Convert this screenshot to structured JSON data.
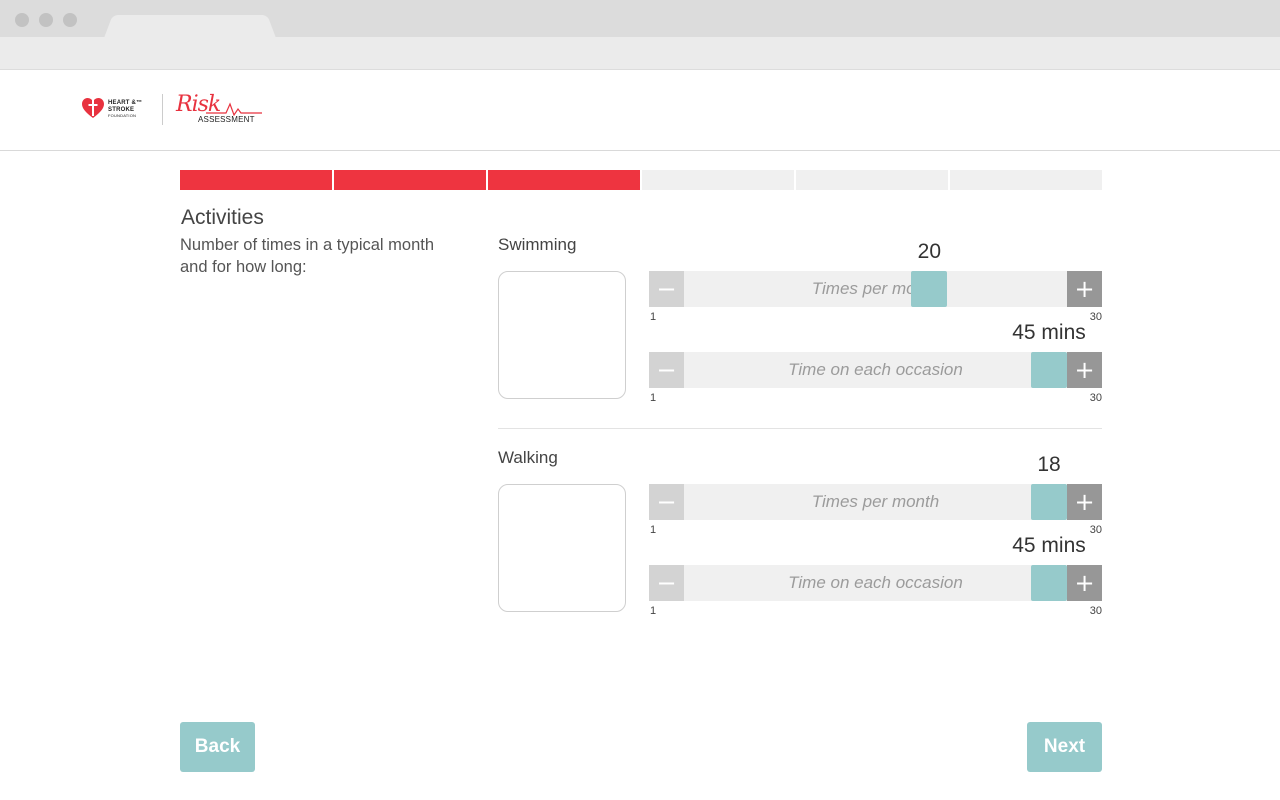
{
  "header": {
    "hs_logo_line1": "HEART &™",
    "hs_logo_line2": "STROKE",
    "hs_logo_line3": "FOUNDATION",
    "risk_word": "Risk",
    "risk_sub": "ASSESSMENT"
  },
  "progress": {
    "total_steps": 6,
    "completed_steps": 3,
    "accent": "#ee3440"
  },
  "section": {
    "title": "Activities",
    "description": "Number of times in a typical month and for how long:"
  },
  "activities": [
    {
      "name": "Swimming",
      "sliders": [
        {
          "label": "Times per month",
          "value_text": "20",
          "value": 20,
          "min": "1",
          "max": "30"
        },
        {
          "label": "Time on each occasion",
          "value_text": "45 mins",
          "value": 30,
          "min": "1",
          "max": "30"
        }
      ]
    },
    {
      "name": "Walking",
      "sliders": [
        {
          "label": "Times per month",
          "value_text": "18",
          "value": 30,
          "min": "1",
          "max": "30"
        },
        {
          "label": "Time on each occasion",
          "value_text": "45 mins",
          "value": 30,
          "min": "1",
          "max": "30"
        }
      ]
    }
  ],
  "nav": {
    "back_label": "Back",
    "next_label": "Next",
    "button_color": "#96cacb"
  },
  "icons": {
    "minus": "minus-icon",
    "plus": "plus-icon"
  }
}
